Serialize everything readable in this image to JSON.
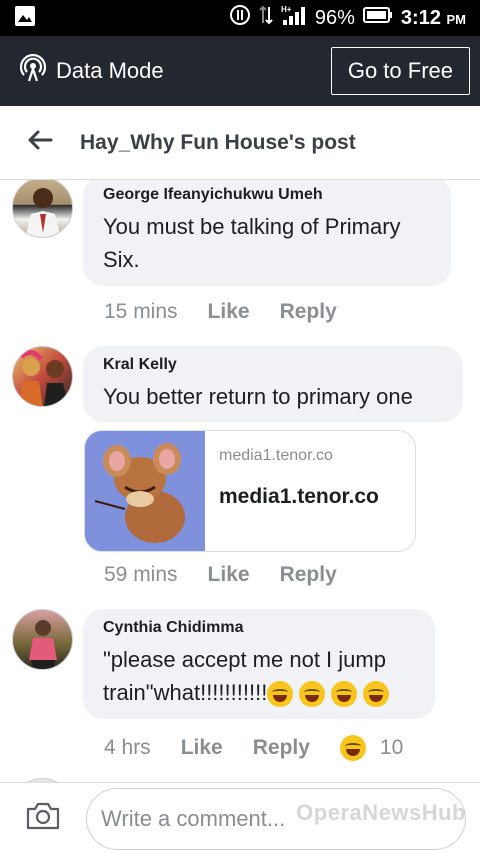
{
  "status_bar": {
    "battery": "96%",
    "time": "3:12",
    "ampm": "PM",
    "network": "H+"
  },
  "data_bar": {
    "mode_label": "Data Mode",
    "go_free_label": "Go to Free"
  },
  "header": {
    "title": "Hay_Why Fun House's post"
  },
  "comments": [
    {
      "author": "George Ifeanyichukwu Umeh",
      "text_line1": "You must be talking of Primary",
      "text_line2": "Six.",
      "time": "15 mins",
      "like": "Like",
      "reply": "Reply"
    },
    {
      "author": "Kral Kelly",
      "text": "You better return to primary one",
      "link_domain": "media1.tenor.co",
      "link_title": "media1.tenor.co",
      "time": "59 mins",
      "like": "Like",
      "reply": "Reply"
    },
    {
      "author": "Cynthia Chidimma",
      "text_line1": "\"please accept me not I jump",
      "text_line2": "train\"what!!!!!!!!!!!",
      "time": "4 hrs",
      "like": "Like",
      "reply": "Reply",
      "reaction_count": "10"
    }
  ],
  "composer": {
    "placeholder": "Write a comment..."
  },
  "watermark": "OperaNewsHub",
  "colors": {
    "dark_bar": "#23272f",
    "bubble": "#f0f2f5",
    "muted_text": "#8a8d91"
  }
}
